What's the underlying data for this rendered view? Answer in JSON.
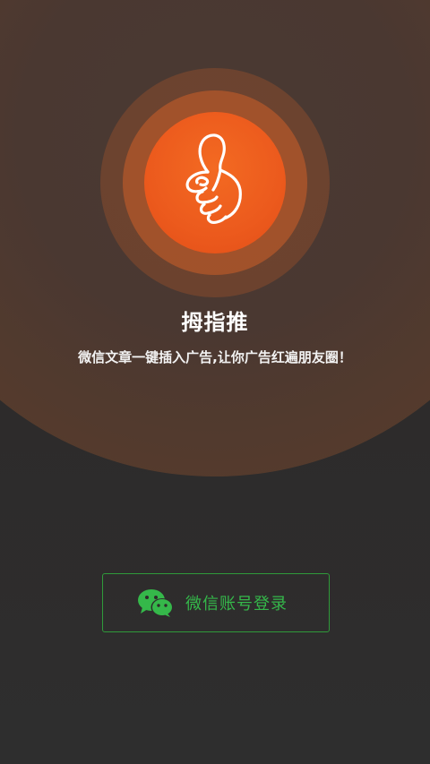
{
  "app": {
    "title": "拇指推",
    "subtitle": "微信文章一键插入广告,让你广告红遍朋友圈！"
  },
  "login": {
    "button_label": "微信账号登录",
    "icon": "wechat-icon"
  },
  "hero": {
    "icon": "thumbs-up-icon"
  },
  "colors": {
    "accent_orange": "#ec5a1d",
    "wechat_green": "#35b84a",
    "background": "#2c2c2c"
  }
}
